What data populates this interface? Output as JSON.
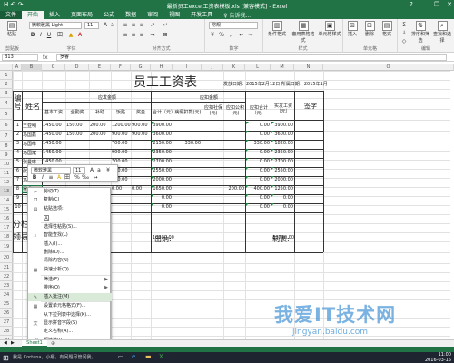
{
  "window": {
    "title": "最新员工excel工资表模板.xls [兼容模式] - Excel",
    "quick_access": "H ↶ ↷",
    "controls": [
      "?",
      "—",
      "❐",
      "✕"
    ]
  },
  "ribbon": {
    "tabs": [
      "文件",
      "开始",
      "插入",
      "页面布局",
      "公式",
      "数据",
      "审阅",
      "视图",
      "开发工具"
    ],
    "active_tab": "开始",
    "tell_me": "♀ 告诉我...",
    "font_name": "微软雅黑 Light",
    "font_size": "11",
    "number_format": "常规",
    "groups": [
      "剪贴板",
      "字体",
      "对齐方式",
      "数字",
      "样式",
      "单元格",
      "编辑"
    ],
    "buttons": {
      "paste": "粘贴",
      "cond_format": "条件格式",
      "table_format": "套用表格格式",
      "cell_styles": "单元格样式",
      "insert": "插入",
      "delete": "删除",
      "format": "格式",
      "sort_filter": "排序和筛选",
      "find_select": "查找和选择"
    }
  },
  "formula_bar": {
    "name_box": "B13",
    "fx": "fx",
    "content": "罗睿"
  },
  "columns": [
    "A",
    "B",
    "C",
    "D",
    "E",
    "F",
    "G",
    "H",
    "I",
    "J",
    "K",
    "L",
    "M",
    "N",
    "O"
  ],
  "rows": [
    "1",
    "2",
    "3",
    "4",
    "5",
    "6",
    "7",
    "8",
    "9",
    "10",
    "11",
    "12",
    "13",
    "14",
    "15",
    "16",
    "17",
    "18",
    "19",
    "20",
    "21",
    "22",
    "23",
    "24",
    "25",
    "26",
    "27",
    "28",
    "29",
    "30"
  ],
  "sheet": {
    "title": "员工工资表",
    "issue_date": "发放日期：2015年2月12日 所属日期：2015年1月",
    "headers": {
      "no": "编号",
      "name": "姓名",
      "due_group": "应发金额",
      "basic": "基本工资",
      "allowance": "全勤奖",
      "subsidy": "补助",
      "meal": "饭贴",
      "bonus": "奖金",
      "total": "合计（元）",
      "deduct_group": "应扣金额",
      "sick": "病假扣款(元)",
      "social_1": "应扣社保(元)",
      "social_2": "应扣公积(元)",
      "deduct_total": "应扣合计（元）",
      "net": "实发工资（元）",
      "sign": "签字"
    },
    "data_rows": [
      {
        "no": "1",
        "name": "王亚明",
        "vals": [
          "1450.00",
          "150.00",
          "200.00",
          "1200.00",
          "900.00",
          "3900.00",
          "",
          "",
          "",
          "0.00",
          "3900.00"
        ]
      },
      {
        "no": "2",
        "name": "马国鑫",
        "vals": [
          "1450.00",
          "150.00",
          "200.00",
          "900.00",
          "900.00",
          "3600.00",
          "",
          "",
          "",
          "0.00",
          "3600.00"
        ]
      },
      {
        "no": "3",
        "name": "马国维",
        "vals": [
          "1450.00",
          "",
          "",
          "700.00",
          "",
          "2150.00",
          "330.00",
          "",
          "",
          "330.00",
          "1820.00"
        ]
      },
      {
        "no": "4",
        "name": "马国斌",
        "vals": [
          "1450.00",
          "",
          "",
          "900.00",
          "",
          "2350.00",
          "",
          "",
          "",
          "0.00",
          "2350.00"
        ]
      },
      {
        "no": "5",
        "name": "张曼琳",
        "vals": [
          "1450.00",
          "",
          "",
          "700.00",
          "",
          "2700.00",
          "",
          "",
          "",
          "0.00",
          "2700.00"
        ]
      },
      {
        "no": "6",
        "name": "张曼琳",
        "vals": [
          "",
          "",
          "",
          "600.00",
          "",
          "2550.00",
          "",
          "",
          "",
          "0.00",
          "2550.00"
        ]
      },
      {
        "no": "7",
        "name": "马昆",
        "vals": [
          "",
          "",
          "",
          "700.00",
          "",
          "2000.00",
          "",
          "",
          "",
          "0.00",
          "2000.00"
        ]
      },
      {
        "no": "8",
        "name": "罗睿",
        "vals": [
          "",
          "",
          "",
          "0.00",
          "0.00",
          "1650.00",
          "",
          "200.00",
          "200.00",
          "400.00",
          "1250.00"
        ]
      },
      {
        "no": "9",
        "name": "",
        "vals": [
          "",
          "",
          "",
          "",
          "",
          "0.00",
          "",
          "",
          "",
          "0.00",
          "0.00"
        ]
      },
      {
        "no": "10",
        "name": "",
        "vals": [
          "",
          "",
          "",
          "",
          "",
          "0.00",
          "",
          "",
          "",
          "0.00",
          "0.00"
        ]
      }
    ],
    "total_label": "分栏合计",
    "grand_total": "18600.00",
    "grand_net": "18770.00",
    "leader_label": "领导签",
    "cashier_label": "出纳:",
    "preparer_label": "制表:"
  },
  "mini_toolbar": {
    "font": "微软雅黑",
    "size": "11",
    "buttons": [
      "B",
      "I",
      "≡",
      "A",
      "田",
      "%",
      "‰",
      "↔"
    ]
  },
  "context_menu": [
    {
      "label": "剪切(T)",
      "icon": "scissors-icon",
      "glyph": "✂"
    },
    {
      "label": "复制(C)",
      "icon": "copy-icon",
      "glyph": "❐"
    },
    {
      "label": "粘贴选项:",
      "icon": "paste-icon",
      "glyph": "▤"
    },
    {
      "label": "",
      "icon": "paste-option-icon",
      "glyph": "A"
    },
    {
      "label": "选择性粘贴(S)...",
      "icon": "",
      "glyph": ""
    },
    {
      "label": "智能查找(L)",
      "icon": "search-icon",
      "glyph": "⌕"
    },
    {
      "label": "插入(I)...",
      "icon": "",
      "glyph": ""
    },
    {
      "label": "删除(D)...",
      "icon": "",
      "glyph": ""
    },
    {
      "label": "清除内容(N)",
      "icon": "",
      "glyph": ""
    },
    {
      "label": "快速分析(Q)",
      "icon": "quick-analysis-icon",
      "glyph": "▦"
    },
    {
      "label": "筛选(E)",
      "icon": "",
      "glyph": "",
      "sub": true
    },
    {
      "label": "排序(O)",
      "icon": "",
      "glyph": "",
      "sub": true
    },
    {
      "label": "插入批注(M)",
      "icon": "comment-icon",
      "glyph": "✎",
      "highlight": true
    },
    {
      "label": "设置单元格格式(F)...",
      "icon": "format-cells-icon",
      "glyph": "▦"
    },
    {
      "label": "从下拉列表中选择(K)...",
      "icon": "",
      "glyph": ""
    },
    {
      "label": "显示拼音字段(S)",
      "icon": "pinyin-icon",
      "glyph": "文"
    },
    {
      "label": "定义名称(A)...",
      "icon": "",
      "glyph": ""
    },
    {
      "label": "超链接(I)...",
      "icon": "link-icon",
      "glyph": "🔗"
    }
  ],
  "sheet_tabs": [
    "◀",
    "▶",
    "Sheet1",
    "⊕"
  ],
  "taskbar": {
    "search": "我是 Cortana，小娜。有问题尽管问我。",
    "time": "11:00",
    "date": "2016-03-15"
  },
  "watermark": {
    "text": "我爱IT技术网",
    "url": "jingyan.baidu.com"
  },
  "colors": {
    "excel_green": "#217346",
    "comment_triangle": "#1f8a3d",
    "menu_highlight": "#d9ead9",
    "watermark_blue": "#4696d7"
  }
}
